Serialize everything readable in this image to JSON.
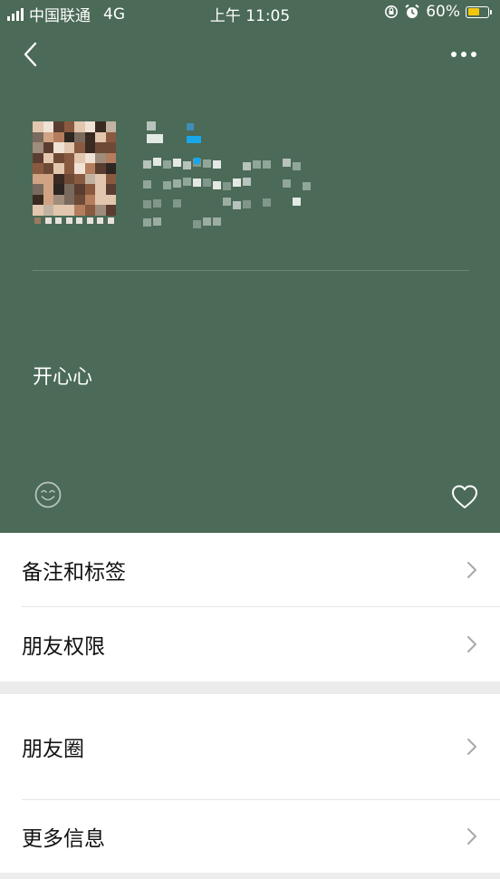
{
  "status_bar": {
    "carrier": "中国联通",
    "network": "4G",
    "time": "上午 11:05",
    "battery_percent": "60%",
    "battery_level": 0.6,
    "battery_color": "#f3c60e",
    "icons": [
      "signal-icon",
      "rotation-lock-icon",
      "alarm-icon",
      "battery-icon"
    ]
  },
  "nav": {
    "back_icon": "chevron-left-icon",
    "more_icon": "more-dots-icon"
  },
  "profile": {
    "background_color": "#4b6a57",
    "signature": "开心心",
    "left_action_icon": "smile-icon",
    "right_action_icon": "heart-icon"
  },
  "menu_group_1": [
    {
      "label": "备注和标签"
    },
    {
      "label": "朋友权限"
    }
  ],
  "menu_group_2": [
    {
      "label": "朋友圈"
    },
    {
      "label": "更多信息"
    }
  ]
}
